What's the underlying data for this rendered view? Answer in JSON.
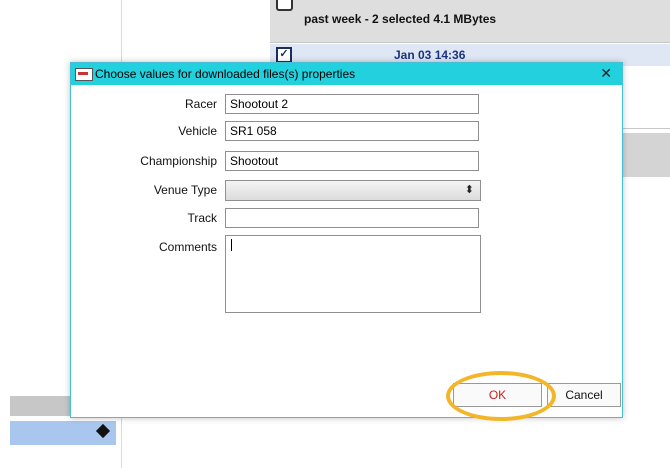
{
  "background": {
    "list_header": "past week  - 2 selected 4.1 MBytes",
    "list_row_date": "Jan 03 14:36",
    "row_check_glyph": "✓"
  },
  "dialog": {
    "title": "Choose values for downloaded files(s) properties",
    "close_glyph": "✕",
    "fields": [
      {
        "label": "Racer",
        "value": "Shootout 2"
      },
      {
        "label": "Vehicle",
        "value": "SR1 058"
      },
      {
        "label": "Championship",
        "value": "Shootout"
      },
      {
        "label": "Venue Type",
        "value": ""
      },
      {
        "label": "Track",
        "value": ""
      },
      {
        "label": "Comments",
        "value": ""
      }
    ],
    "select_arrow": "⬍",
    "buttons": {
      "ok": "OK",
      "cancel": "Cancel"
    }
  },
  "colors": {
    "titlebar": "#23d0de",
    "ok_text": "#d21d1d",
    "highlight_ring": "#f2b628",
    "selected_row": "#dfe7f5",
    "date_text": "#1b3480"
  },
  "icons": [
    "app-icon",
    "close-icon",
    "dropdown-arrow-icon",
    "tag-icon",
    "checkbox-icon"
  ]
}
